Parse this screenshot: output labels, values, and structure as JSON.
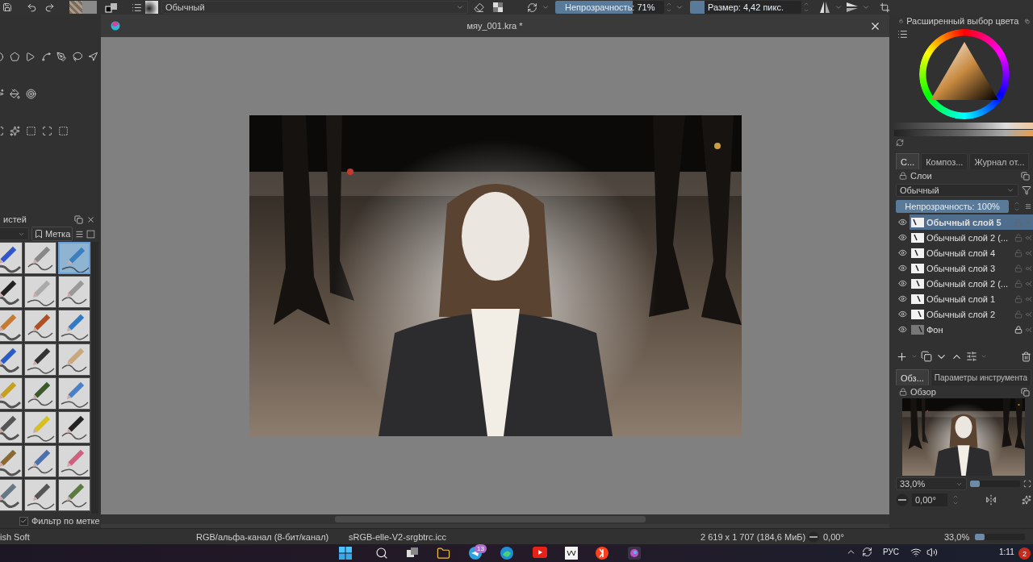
{
  "toolbar": {
    "blend_mode": "Обычный",
    "opacity": {
      "label": "Непрозрачность: 71%",
      "level": 0.71
    },
    "size": {
      "label": "Размер: 4,42 пикс.",
      "level": 0.13
    }
  },
  "document": {
    "title": "мяу_001.kra *"
  },
  "brush_docker": {
    "title": "истей",
    "tag_button": "Метка",
    "brushes": [
      {
        "selected": false
      },
      {
        "selected": false
      },
      {
        "selected": true
      },
      {
        "selected": false
      },
      {
        "selected": false
      },
      {
        "selected": false
      },
      {
        "selected": false
      },
      {
        "selected": false
      },
      {
        "selected": false
      },
      {
        "selected": false
      },
      {
        "selected": false
      },
      {
        "selected": false
      },
      {
        "selected": false
      },
      {
        "selected": false
      },
      {
        "selected": false
      },
      {
        "selected": false
      },
      {
        "selected": false
      },
      {
        "selected": false
      },
      {
        "selected": false
      },
      {
        "selected": false
      },
      {
        "selected": false
      },
      {
        "selected": false
      },
      {
        "selected": false
      },
      {
        "selected": false
      }
    ],
    "filter": {
      "label": "Фильтр по метке",
      "checked": true
    }
  },
  "color_docker": {
    "title": "Расширенный выбор цвета"
  },
  "dock_tabs": [
    {
      "label": "С...",
      "selected": true
    },
    {
      "label": "Композ...",
      "selected": false
    },
    {
      "label": "Журнал от...",
      "selected": false
    }
  ],
  "layers": {
    "title": "Слои",
    "blend_mode": "Обычный",
    "opacity": {
      "label": "Непрозрачность:  100%",
      "level": 1
    },
    "items": [
      {
        "name": "Обычный слой 5",
        "selected": true,
        "locked": false
      },
      {
        "name": "Обычный слой 2 (...",
        "selected": false,
        "locked": false
      },
      {
        "name": "Обычный слой 4",
        "selected": false,
        "locked": false
      },
      {
        "name": "Обычный слой 3",
        "selected": false,
        "locked": false
      },
      {
        "name": "Обычный слой 2 (...",
        "selected": false,
        "locked": false
      },
      {
        "name": "Обычный слой 1",
        "selected": false,
        "locked": false
      },
      {
        "name": "Обычный слой 2",
        "selected": false,
        "locked": false
      },
      {
        "name": "Фон",
        "selected": false,
        "locked": true
      }
    ]
  },
  "lower_tabs": [
    {
      "label": "Обз...",
      "selected": true
    },
    {
      "label": "Параметры инструмента",
      "selected": false
    }
  ],
  "overview": {
    "title": "Обзор",
    "zoom": "33,0%",
    "zoom_slider": {
      "level": 0.2
    },
    "rotation": "0,00°"
  },
  "status_bar": {
    "preset": "ish Soft",
    "color_space": "RGB/альфа-канал (8-бит/канал)",
    "profile": "sRGB-elle-V2-srgbtrc.icc",
    "dimensions": "2 619 x 1 707 (184,6 МиБ)",
    "rotation": "0,00°",
    "zoom": "33,0%",
    "zoom_slider": {
      "level": 0.2
    }
  },
  "taskbar": {
    "badge": "13",
    "language": "РУС",
    "time": "1:11",
    "notifications": "2"
  }
}
